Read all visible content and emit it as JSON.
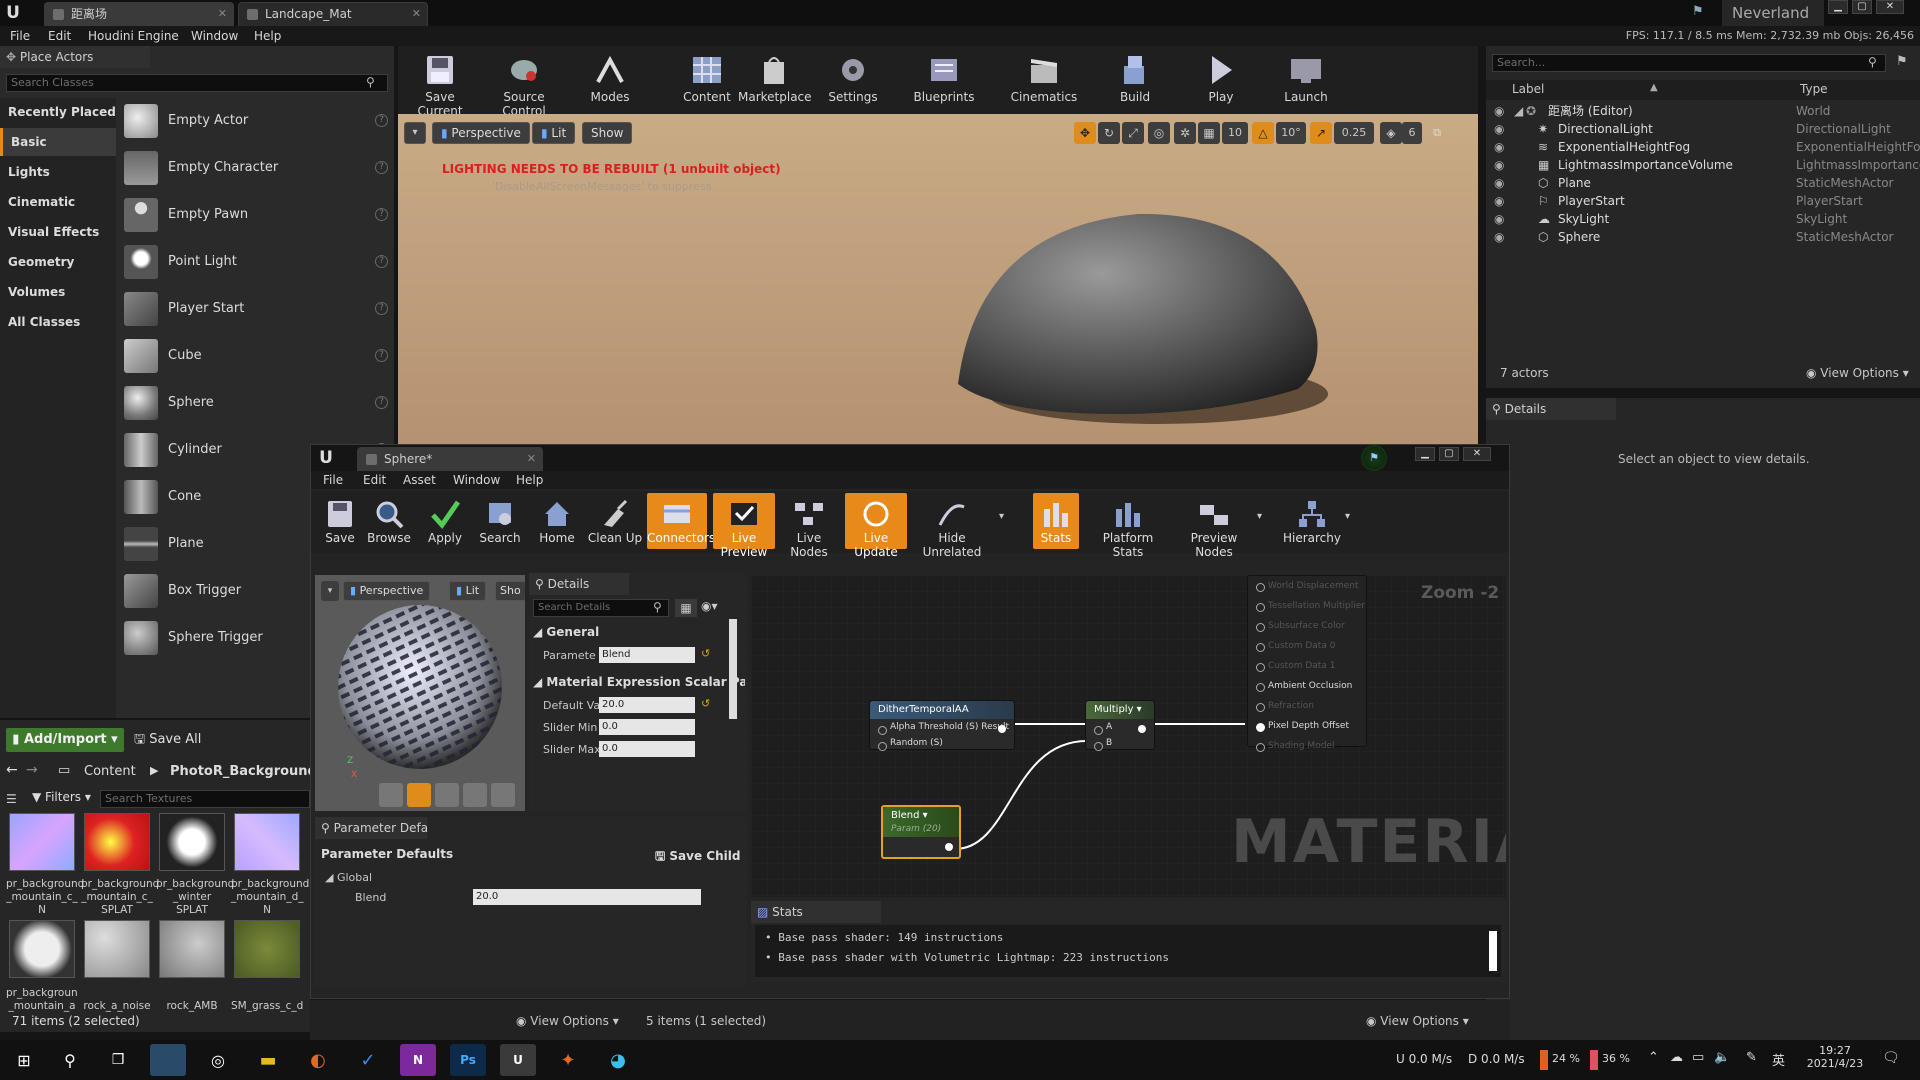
{
  "titlebar": {
    "tabs": [
      {
        "label": "距离场"
      },
      {
        "label": "Landcape_Mat"
      }
    ],
    "project": "Neverland"
  },
  "menubar": {
    "items": [
      "File",
      "Edit",
      "Houdini Engine",
      "Window",
      "Help"
    ],
    "perf": "FPS: 117.1  / 8.5 ms  Mem: 2,732.39 mb  Objs: 26,456"
  },
  "place_actors": {
    "title": "Place Actors",
    "search_placeholder": "Search Classes",
    "categories": [
      "Recently Placed",
      "Basic",
      "Lights",
      "Cinematic",
      "Visual Effects",
      "Geometry",
      "Volumes",
      "All Classes"
    ],
    "selected_category": "Basic",
    "actors": [
      "Empty Actor",
      "Empty Character",
      "Empty Pawn",
      "Point Light",
      "Player Start",
      "Cube",
      "Sphere",
      "Cylinder",
      "Cone",
      "Plane",
      "Box Trigger",
      "Sphere Trigger"
    ]
  },
  "toolbar": {
    "buttons": [
      "Save Current",
      "Source Control",
      "Modes",
      "Content",
      "Marketplace",
      "Settings",
      "Blueprints",
      "Cinematics",
      "Build",
      "Play",
      "Launch"
    ]
  },
  "viewport": {
    "perspective": "Perspective",
    "lit": "Lit",
    "show": "Show",
    "warning": "LIGHTING NEEDS TO BE REBUILT (1 unbuilt object)",
    "suppress": "'DisableAllScreenMessages' to suppress",
    "snap_values": [
      "10",
      "10°",
      "0.25",
      "6"
    ]
  },
  "outliner": {
    "search_placeholder": "Search...",
    "col_label": "Label",
    "col_type": "Type",
    "rows": [
      {
        "label": "距离场 (Editor)",
        "type": "World"
      },
      {
        "label": "DirectionalLight",
        "type": "DirectionalLight"
      },
      {
        "label": "ExponentialHeightFog",
        "type": "ExponentialHeightFog"
      },
      {
        "label": "LightmassImportanceVolume",
        "type": "LightmassImportance"
      },
      {
        "label": "Plane",
        "type": "StaticMeshActor"
      },
      {
        "label": "PlayerStart",
        "type": "PlayerStart"
      },
      {
        "label": "SkyLight",
        "type": "SkyLight"
      },
      {
        "label": "Sphere",
        "type": "StaticMeshActor"
      }
    ],
    "count": "7 actors",
    "view_options": "View Options"
  },
  "details_panel": {
    "title": "Details",
    "empty_msg": "Select an object to view details."
  },
  "content_browser": {
    "add_import": "Add/Import",
    "save_all": "Save All",
    "breadcrumb": [
      "Content",
      "PhotoR_Backgrounds"
    ],
    "filters": "Filters",
    "search_placeholder": "Search Textures",
    "assets_row1": [
      {
        "name": "pr_background _mountain_c_ N"
      },
      {
        "name": "pr_background _mountain_c_ SPLAT"
      },
      {
        "name": "pr_background _winter SPLAT"
      },
      {
        "name": "pr_background _mountain_d_ N"
      }
    ],
    "assets_row2": [
      {
        "name": "pr_background _mountain_a"
      },
      {
        "name": "rock_a_noise"
      },
      {
        "name": "rock_AMB"
      },
      {
        "name": "SM_grass_c_d"
      }
    ],
    "status": "71 items (2 selected)",
    "view_options": "View Options"
  },
  "material_editor": {
    "tab": "Sphere*",
    "menu": [
      "File",
      "Edit",
      "Asset",
      "Window",
      "Help"
    ],
    "toolbar": [
      {
        "label": "Save",
        "on": false
      },
      {
        "label": "Browse",
        "on": false
      },
      {
        "label": "Apply",
        "on": false
      },
      {
        "label": "Search",
        "on": false
      },
      {
        "label": "Home",
        "on": false
      },
      {
        "label": "Clean Up",
        "on": false
      },
      {
        "label": "Connectors",
        "on": true
      },
      {
        "label": "Live Preview",
        "on": true
      },
      {
        "label": "Live Nodes",
        "on": false
      },
      {
        "label": "Live Update",
        "on": true
      },
      {
        "label": "Hide Unrelated",
        "on": false
      },
      {
        "label": "Stats",
        "on": true
      },
      {
        "label": "Platform Stats",
        "on": false
      },
      {
        "label": "Preview Nodes",
        "on": false
      },
      {
        "label": "Hierarchy",
        "on": false
      }
    ],
    "preview": {
      "perspective": "Perspective",
      "lit": "Lit",
      "show": "Sho"
    },
    "details": {
      "title": "Details",
      "search_placeholder": "Search Details",
      "general": "General",
      "param_label": "Paramete",
      "param_value": "Blend",
      "section": "Material Expression Scalar Para",
      "default_label": "Default Va",
      "default_value": "20.0",
      "slider_min_label": "Slider Min",
      "slider_min": "0.0",
      "slider_max_label": "Slider Max",
      "slider_max": "0.0"
    },
    "param_defaults": {
      "tab": "Parameter Default",
      "title": "Parameter Defaults",
      "save_child": "Save Child",
      "global": "Global",
      "blend_label": "Blend",
      "blend_value": "20.0"
    },
    "graph": {
      "zoom": "Zoom -2",
      "watermark": "MATERIAL",
      "dither_node": "DitherTemporalAA",
      "dither_pins": [
        "Alpha Threshold (S)",
        "Random (S)"
      ],
      "dither_out": "Result",
      "multiply_node": "Multiply",
      "multiply_pins": [
        "A",
        "B"
      ],
      "blend_node": "Blend",
      "blend_sub": "Param (20)",
      "result_pins": [
        "World Displacement",
        "Tessellation Multiplier",
        "Subsurface Color",
        "Custom Data 0",
        "Custom Data 1",
        "Ambient Occlusion",
        "Refraction",
        "Pixel Depth Offset",
        "Shading Model"
      ]
    },
    "stats": {
      "tab": "Stats",
      "lines": [
        "Base pass shader: 149 instructions",
        "Base pass shader with Volumetric Lightmap: 223 instructions"
      ]
    },
    "status": "5 items (1 selected)",
    "view_options": "View Options"
  },
  "taskbar": {
    "net_up": "U 0.0 M/s",
    "net_down": "D 0.0 M/s",
    "cpu": "24 %",
    "mem": "36 %",
    "lang": "英",
    "time": "19:27",
    "date": "2021/4/23"
  }
}
